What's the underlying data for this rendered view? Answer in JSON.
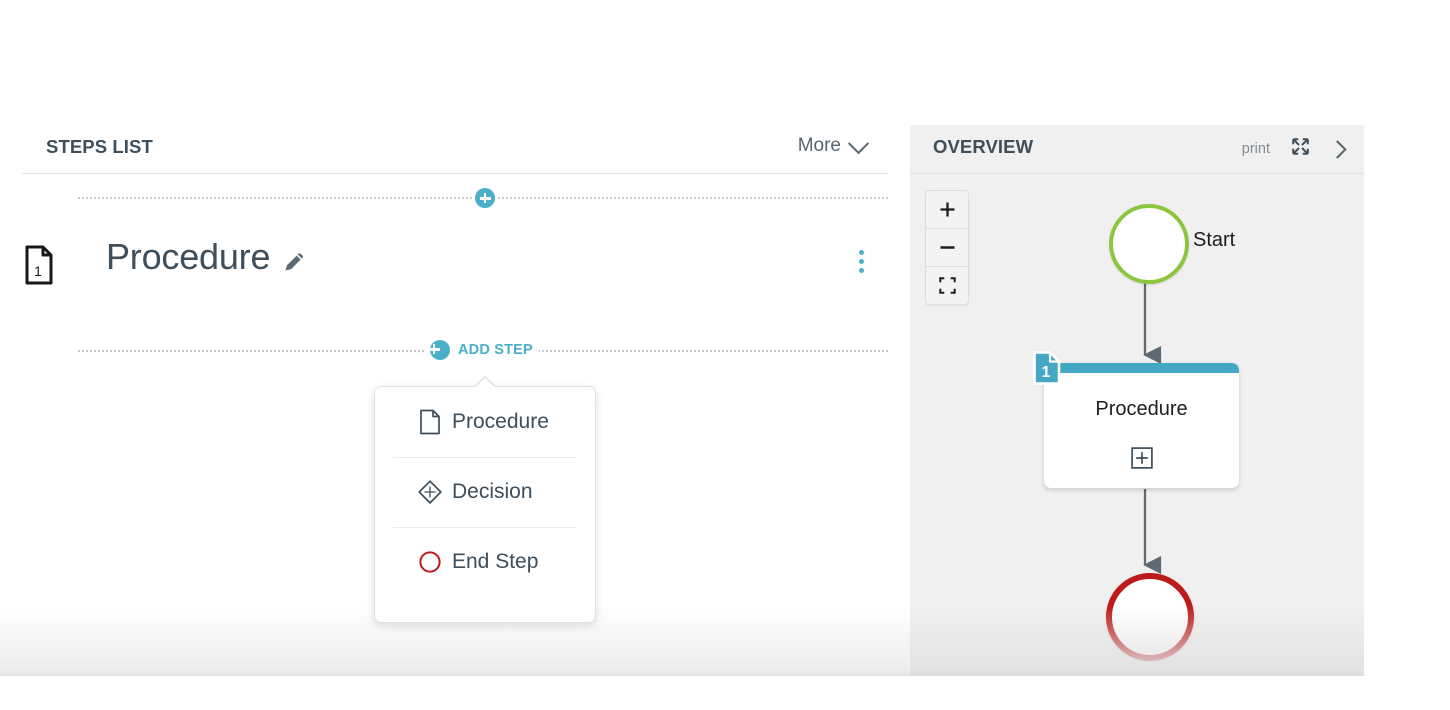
{
  "steps_panel": {
    "title": "STEPS LIST",
    "more_label": "More",
    "more_icon": "chevron-down-icon",
    "top_insert_icon": "plus-circle-icon",
    "add_step": {
      "label": "ADD STEP",
      "icon": "plus-circle-icon"
    },
    "step": {
      "number": "1",
      "doc_icon": "document-icon",
      "name": "Procedure",
      "edit_icon": "pencil-icon",
      "menu_icon": "kebab-menu-icon"
    },
    "add_step_menu": {
      "items": [
        {
          "label": "Procedure",
          "icon": "document-outline-icon"
        },
        {
          "label": "Decision",
          "icon": "diamond-icon"
        },
        {
          "label": "End Step",
          "icon": "circle-outline-icon"
        }
      ]
    }
  },
  "overview_panel": {
    "title": "OVERVIEW",
    "print_label": "print",
    "expand_icon": "expand-arrows-icon",
    "next_icon": "chevron-right-icon",
    "zoom_controls": {
      "zoom_in_label": "+",
      "zoom_out_label": "−",
      "fit_icon": "fit-to-screen-icon"
    },
    "diagram": {
      "start_label": "Start",
      "procedure_label": "Procedure",
      "procedure_badge": "1",
      "procedure_expand_icon": "plus-box-icon"
    }
  },
  "colors": {
    "accent_teal": "#4aafc8",
    "node_header_teal": "#44a8c4",
    "start_green": "#8cc63e",
    "end_red": "#bd1b1b",
    "text_dark": "#3e4e5b",
    "panel_bg": "#f0f0f0"
  }
}
